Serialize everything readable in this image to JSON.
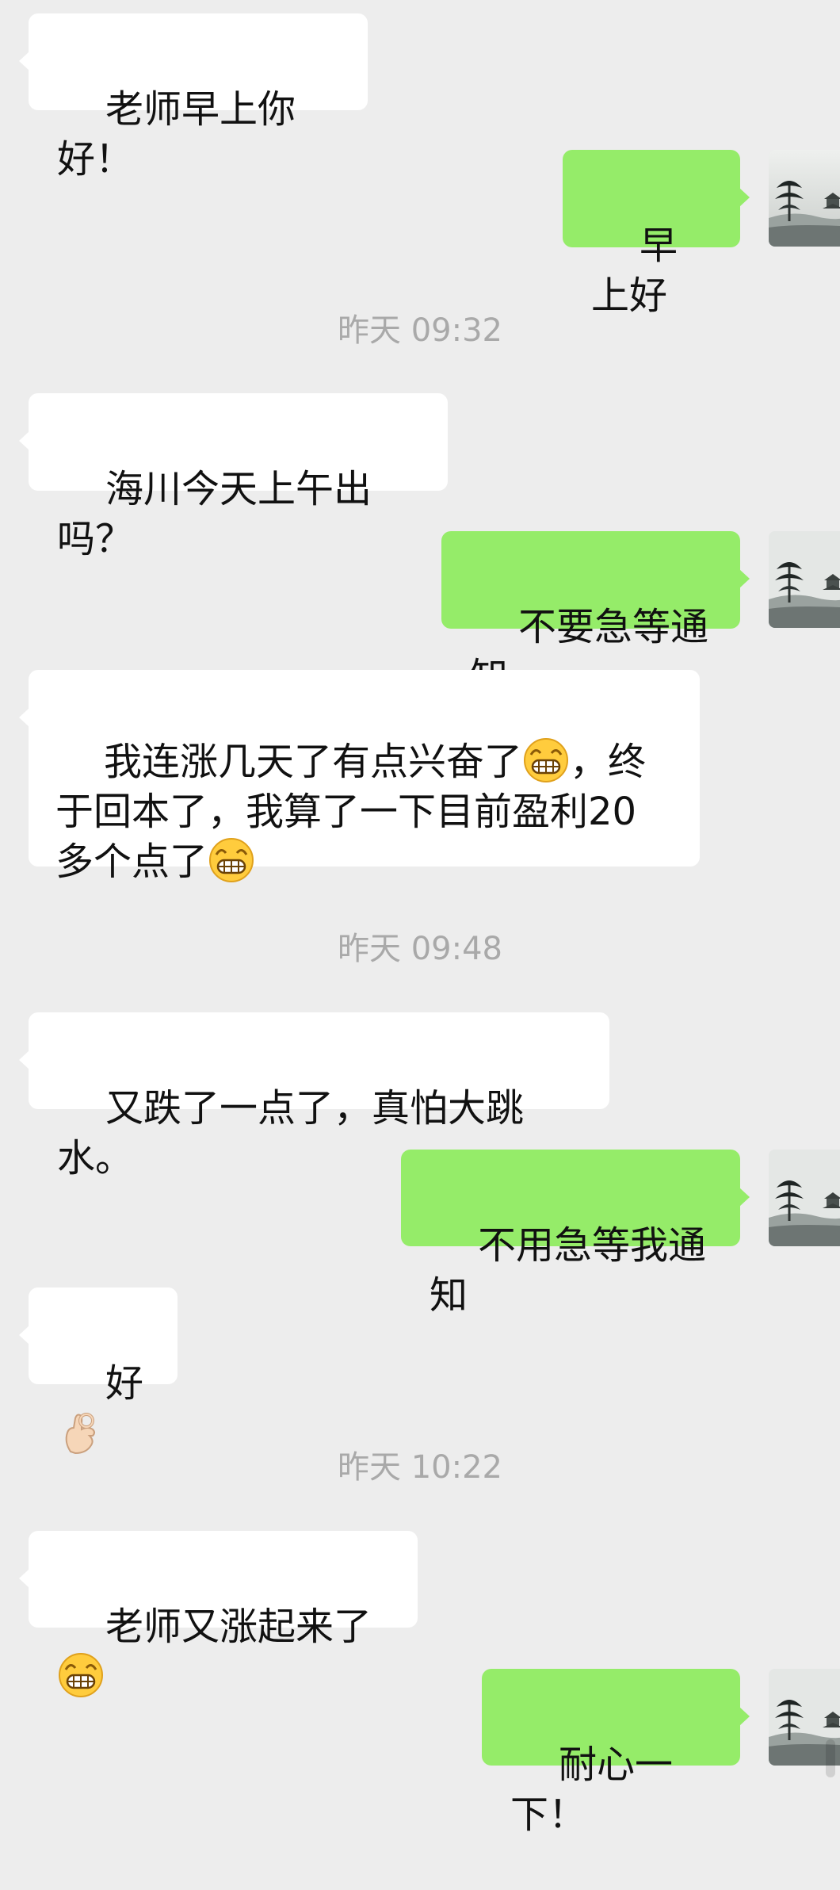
{
  "timestamps": {
    "t1": "昨天 09:32",
    "t2": "昨天 09:48",
    "t3": "昨天 10:22"
  },
  "messages": [
    {
      "side": "in",
      "text": "老师早上你好！"
    },
    {
      "side": "out",
      "text": "早上好"
    },
    {
      "side": "in",
      "text": "海川今天上午出吗？"
    },
    {
      "side": "out",
      "text": "不要急等通知"
    },
    {
      "side": "in",
      "parts": [
        "我连涨几天了有点兴奋了",
        "，终于回本了，我算了一下目前盈利20多个点了"
      ],
      "emoji": "grinning-face-icon"
    },
    {
      "side": "in",
      "text": "又跌了一点了，真怕大跳水。"
    },
    {
      "side": "out",
      "text": "不用急等我通知"
    },
    {
      "side": "in",
      "text": "好",
      "emoji": "ok-hand-icon"
    },
    {
      "side": "in",
      "text": "老师又涨起来了",
      "emoji": "grinning-face-icon"
    },
    {
      "side": "out",
      "text": "耐心一下！"
    }
  ],
  "colors": {
    "background": "#ededed",
    "incoming_bubble": "#ffffff",
    "outgoing_bubble": "#95ec69",
    "timestamp": "#a9a9a9"
  }
}
